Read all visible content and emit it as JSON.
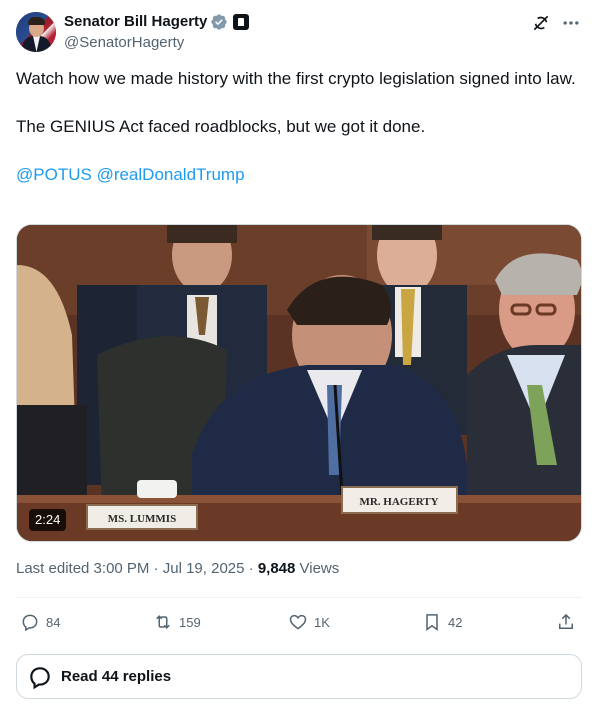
{
  "author": {
    "display_name": "Senator Bill Hagerty",
    "handle": "@SenatorHagerty",
    "avatar_icon": "senator-portrait-avatar",
    "verified_icon": "verified-badge-icon",
    "gov_icon": "government-building-icon"
  },
  "tweet": {
    "line1": "Watch how we made history with the first crypto legislation signed into law.",
    "line2": "The GENIUS Act faced roadblocks, but we got it done.",
    "mention1": "@POTUS",
    "mention2": "@realDonaldTrump"
  },
  "media": {
    "duration": "2:24",
    "nameplate_left": "MS. LUMMIS",
    "nameplate_right": "MR. HAGERTY"
  },
  "meta": {
    "edited": "Last edited 3:00 PM · Jul 19, 2025 · ",
    "views_count": "9,848",
    "views_label": " Views"
  },
  "actions": {
    "replies": "84",
    "reposts": "159",
    "likes": "1K",
    "bookmarks": "42"
  },
  "read_replies": "Read 44 replies",
  "colors": {
    "link": "#1d9bf0",
    "secondary_text": "#536471",
    "primary_text": "#0f1419",
    "verified": "#829aab"
  }
}
